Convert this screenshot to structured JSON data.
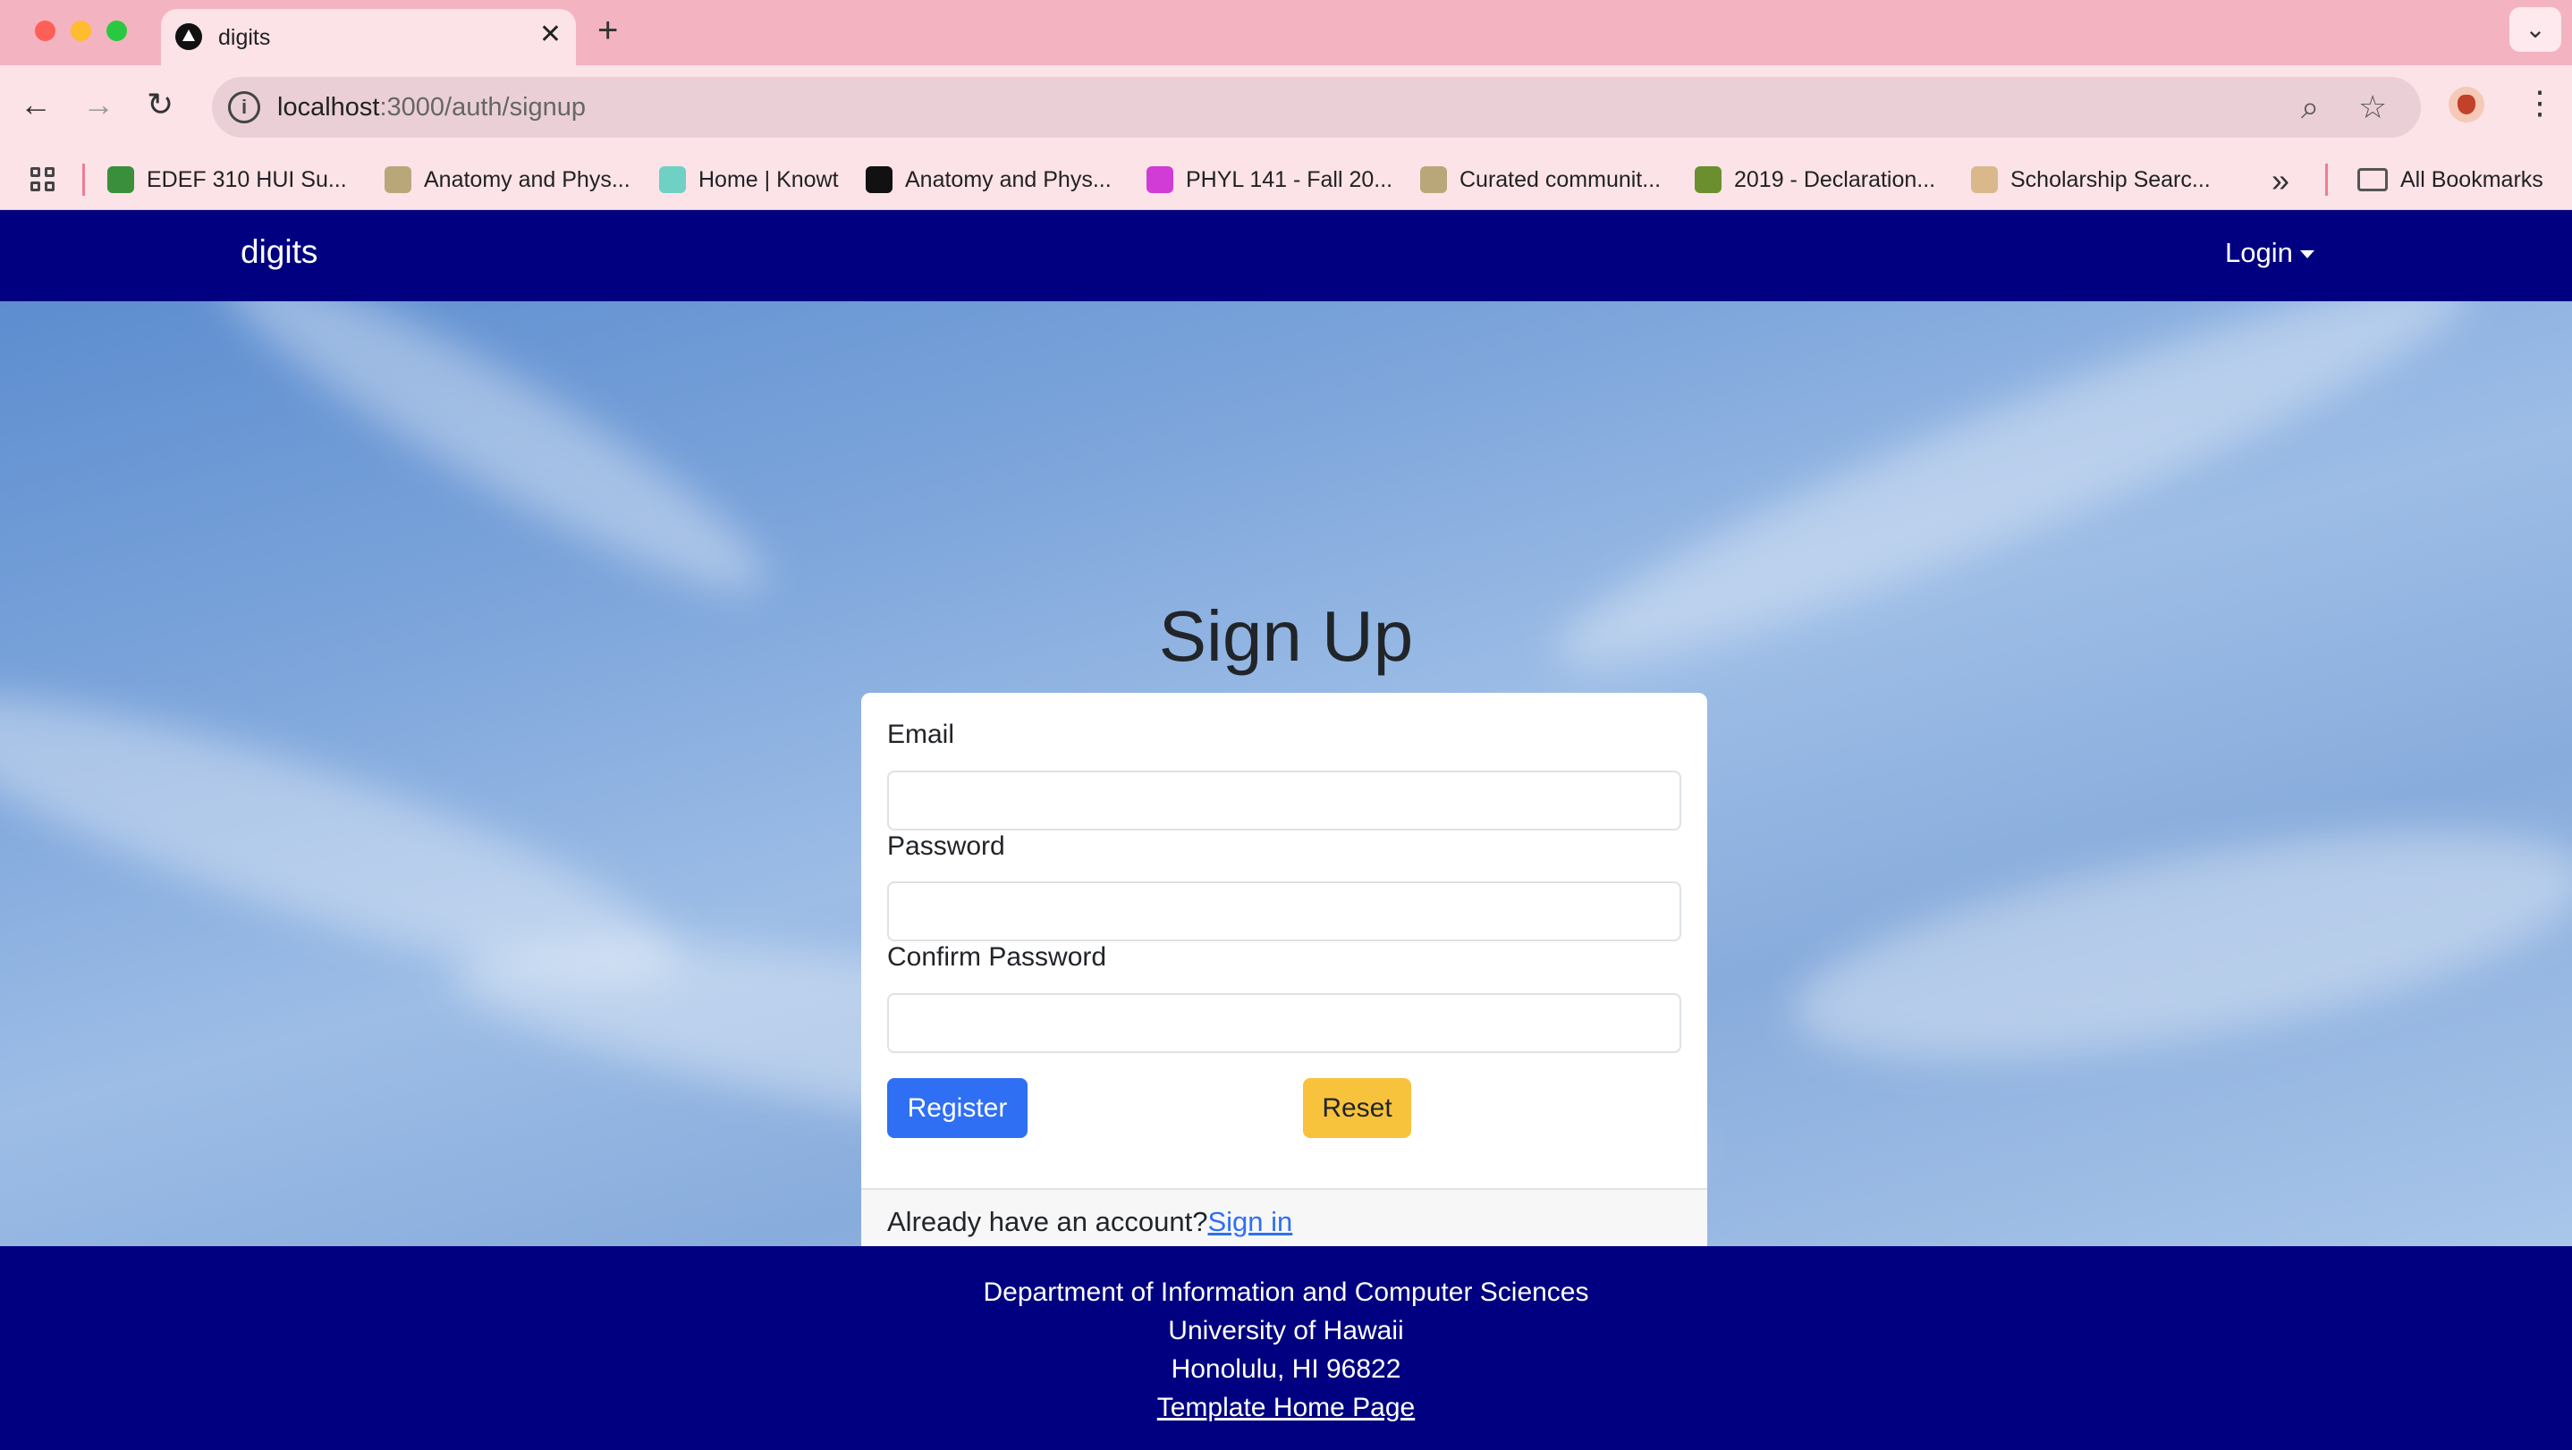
{
  "browser": {
    "tab_title": "digits",
    "url_host": "localhost",
    "url_path": ":3000/auth/signup",
    "bookmarks": [
      {
        "label": "EDEF 310 HUI Su...",
        "color": "#3a8f3a"
      },
      {
        "label": "Anatomy and Phys...",
        "color": "#b9a77a"
      },
      {
        "label": "Home | Knowt",
        "color": "#6fd0c4"
      },
      {
        "label": "Anatomy and Phys...",
        "color": "#111111"
      },
      {
        "label": "PHYL 141 - Fall 20...",
        "color": "#d13bd6"
      },
      {
        "label": "Curated communit...",
        "color": "#b9a77a"
      },
      {
        "label": "2019 - Declaration...",
        "color": "#6b8f2e"
      },
      {
        "label": "Scholarship Searc...",
        "color": "#d9b98a"
      }
    ],
    "all_bookmarks_label": "All Bookmarks"
  },
  "navbar": {
    "brand": "digits",
    "login_label": "Login"
  },
  "signup": {
    "heading": "Sign Up",
    "email_label": "Email",
    "password_label": "Password",
    "confirm_label": "Confirm Password",
    "register_label": "Register",
    "reset_label": "Reset",
    "footer_text": "Already have an account?",
    "signin_label": "Sign in"
  },
  "footer": {
    "line1": "Department of Information and Computer Sciences",
    "line2": "University of Hawaii",
    "line3": "Honolulu, HI 96822",
    "link": "Template Home Page"
  },
  "colors": {
    "navbar": "#000080",
    "primary": "#2f6ff4",
    "warning": "#f8c33c"
  }
}
